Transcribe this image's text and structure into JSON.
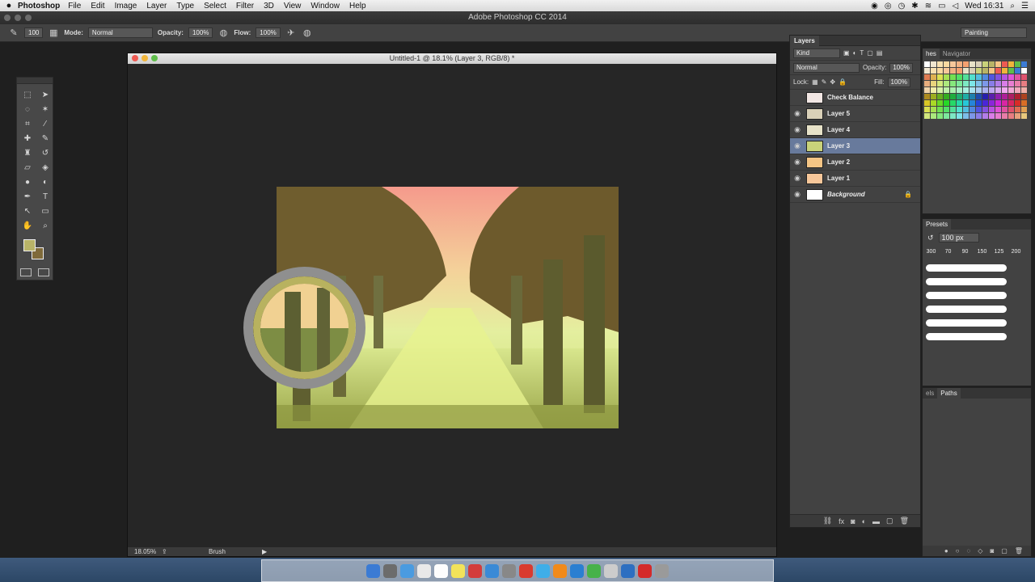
{
  "menubar": {
    "app": "Photoshop",
    "items": [
      "File",
      "Edit",
      "Image",
      "Layer",
      "Type",
      "Select",
      "Filter",
      "3D",
      "View",
      "Window",
      "Help"
    ],
    "clock": "Wed 16:31"
  },
  "window": {
    "title": "Adobe Photoshop CC 2014"
  },
  "options": {
    "brush_size": "100",
    "mode_label": "Mode:",
    "mode_value": "Normal",
    "opacity_label": "Opacity:",
    "opacity_value": "100%",
    "flow_label": "Flow:",
    "flow_value": "100%",
    "workspace": "Painting"
  },
  "document": {
    "title": "Untitled-1 @ 18.1% (Layer 3, RGB/8) *",
    "zoom": "18.05%",
    "status_tool": "Brush"
  },
  "layers_panel": {
    "tab": "Layers",
    "filter": "Kind",
    "blend": "Normal",
    "opacity_label": "Opacity:",
    "opacity_value": "100%",
    "lock_label": "Lock:",
    "fill_label": "Fill:",
    "fill_value": "100%",
    "layers": [
      {
        "name": "Check Balance",
        "visible": false,
        "selected": false,
        "thumb": "#f2e7e4"
      },
      {
        "name": "Layer 5",
        "visible": true,
        "selected": false,
        "thumb": "#d9d0b8"
      },
      {
        "name": "Layer 4",
        "visible": true,
        "selected": false,
        "thumb": "#e7e2c8"
      },
      {
        "name": "Layer 3",
        "visible": true,
        "selected": true,
        "thumb": "#c9d27a"
      },
      {
        "name": "Layer 2",
        "visible": true,
        "selected": false,
        "thumb": "#f4c585"
      },
      {
        "name": "Layer 1",
        "visible": true,
        "selected": false,
        "thumb": "#f7c79a"
      },
      {
        "name": "Background",
        "visible": true,
        "selected": false,
        "thumb": "#ffffff",
        "locked": true
      }
    ]
  },
  "swatches_panel": {
    "tab_a": "hes",
    "tab_b": "Navigator"
  },
  "presets_panel": {
    "tab": "Presets",
    "size_value": "100 px",
    "sizes": [
      "300",
      "70",
      "90",
      "150",
      "125",
      "200"
    ]
  },
  "paths_panel": {
    "tab_a": "els",
    "tab_b": "Paths"
  },
  "colors": {
    "foreground": "#b9b467",
    "background": "#7f6a3a",
    "selection": "#687a9c"
  }
}
